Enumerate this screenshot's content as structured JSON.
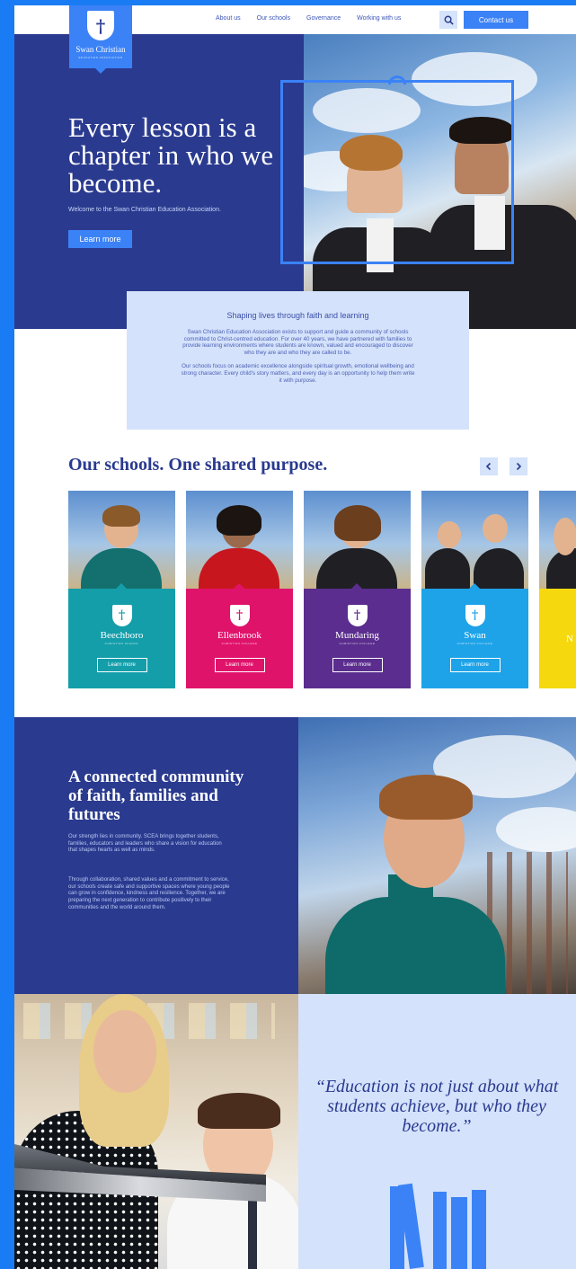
{
  "brand": {
    "name": "Swan Christian",
    "subtitle": "EDUCATION ASSOCIATION",
    "colors": {
      "navy": "#2a3a8f",
      "blue": "#3b82f6",
      "pale": "#d4e2fb",
      "frame": "#1a7cf4"
    }
  },
  "nav": {
    "links": [
      "About us",
      "Our schools",
      "Governance",
      "Working with us"
    ],
    "search_icon": "search-icon",
    "contact_label": "Contact us"
  },
  "hero": {
    "title": "Every lesson is a chapter in who we become.",
    "subtitle": "Welcome to the Swan Christian Education Association.",
    "cta": "Learn more"
  },
  "intro": {
    "title": "Shaping lives through faith and learning",
    "p1": "Swan Christian Education Association exists to support and guide a community of schools committed to Christ-centred education. For over 40 years, we have partnered with families to provide learning environments where students are known, valued and encouraged to discover who they are and who they are called to be.",
    "p2": "Our schools focus on academic excellence alongside spiritual growth, emotional wellbeing and strong character. Every child's story matters, and every day is an opportunity to help them write it with purpose."
  },
  "schools": {
    "title": "Our schools. One shared purpose.",
    "prev_icon": "chevron-left-icon",
    "next_icon": "chevron-right-icon",
    "items": [
      {
        "name": "Beechboro",
        "sub": "CHRISTIAN SCHOOL",
        "cta": "Learn more",
        "color": "#139eaa"
      },
      {
        "name": "Ellenbrook",
        "sub": "CHRISTIAN COLLEGE",
        "cta": "Learn more",
        "color": "#e0136b"
      },
      {
        "name": "Mundaring",
        "sub": "CHRISTIAN COLLEGE",
        "cta": "Learn more",
        "color": "#5b2d8e"
      },
      {
        "name": "Swan",
        "sub": "CHRISTIAN COLLEGE",
        "cta": "Learn more",
        "color": "#1ea3e8"
      },
      {
        "name": "N",
        "sub": "",
        "cta": "",
        "color": "#f5d90e"
      }
    ]
  },
  "community": {
    "title": "A connected community of faith, families and futures",
    "p1": "Our strength lies in community. SCEA brings together students, families, educators and leaders who share a vision for education that shapes hearts as well as minds.",
    "p2": "Through collaboration, shared values and a commitment to service, our schools create safe and supportive spaces where young people can grow in confidence, kindness and resilience. Together, we are preparing the next generation to contribute positively to their communities and the world around them."
  },
  "quote": {
    "text": "“Education is not just about what students achieve, but who they become.”"
  }
}
